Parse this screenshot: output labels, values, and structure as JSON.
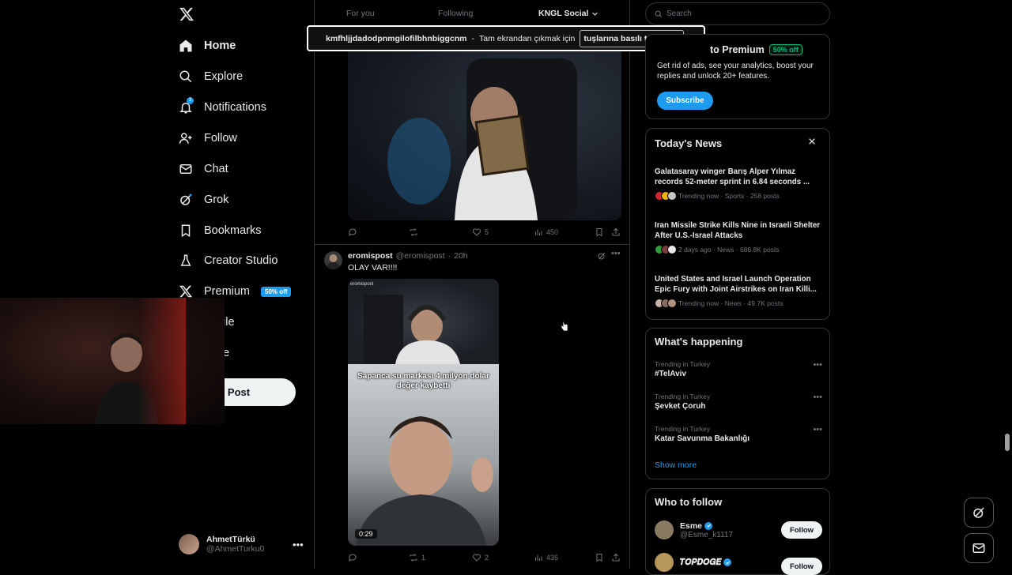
{
  "nav": {
    "items": [
      {
        "label": "Home",
        "icon": "home-icon"
      },
      {
        "label": "Explore",
        "icon": "search-icon"
      },
      {
        "label": "Notifications",
        "icon": "bell-icon",
        "badge": "3"
      },
      {
        "label": "Follow",
        "icon": "follow-icon"
      },
      {
        "label": "Chat",
        "icon": "mail-icon"
      },
      {
        "label": "Grok",
        "icon": "grok-icon"
      },
      {
        "label": "Bookmarks",
        "icon": "bookmark-icon"
      },
      {
        "label": "Creator Studio",
        "icon": "flask-icon"
      },
      {
        "label": "Premium",
        "icon": "x-icon",
        "pill": "50% off"
      },
      {
        "label": "ile"
      },
      {
        "label": "e"
      }
    ],
    "post_label": "Post",
    "me": {
      "name": "AhmetTürkü",
      "handle": "@AhmetTurku0"
    }
  },
  "feed": {
    "tabs": [
      "For you",
      "Following",
      "KNGL Social"
    ],
    "post1_actions": {
      "replies": "",
      "reposts": "",
      "likes": "5",
      "views": "450"
    },
    "post2": {
      "name": "eromispost",
      "handle": "@eromispost",
      "time": "20h",
      "text": "OLAY VAR!!!!",
      "media_brand": "eromispost",
      "media_caption": "Sapanca su markası 4 milyon dolar değer kaybetti",
      "duration": "0:29",
      "actions": {
        "replies": "",
        "reposts": "1",
        "likes": "2",
        "views": "435"
      }
    }
  },
  "toast": {
    "site": "kmfhljjdadodpnmgilofilbhnbiggcnm",
    "dash": "-",
    "text": "Tam ekrandan çıkmak için",
    "key_text": "tuşlarına basılı tutunEsc"
  },
  "right": {
    "search_placeholder": "Search",
    "premium": {
      "title": "to Premium",
      "pill": "50% off",
      "desc": "Get rid of ads, see your analytics, boost your replies and unlock 20+ features.",
      "button": "Subscribe"
    },
    "news": {
      "title": "Today's News",
      "items": [
        {
          "title": "Galatasaray winger Barış Alper Yılmaz records 52-meter sprint in 6.84 seconds ...",
          "meta": "Trending now · Sports · 258 posts"
        },
        {
          "title": "Iran Missile Strike Kills Nine in Israeli Shelter After U.S.-Israel Attacks",
          "meta": "2 days ago · News · 686.8K posts"
        },
        {
          "title": "United States and Israel Launch Operation Epic Fury with Joint Airstrikes on Iran Killi...",
          "meta": "Trending now · News · 49.7K posts"
        }
      ]
    },
    "happening": {
      "title": "What's happening",
      "items": [
        {
          "category": "Trending in Turkey",
          "name": "#TelAviv"
        },
        {
          "category": "Trending in Turkey",
          "name": "Şevket Çoruh"
        },
        {
          "category": "Trending in Turkey",
          "name": "Katar Savunma Bakanlığı"
        }
      ],
      "show_more": "Show more"
    },
    "who_to_follow": {
      "title": "Who to follow",
      "items": [
        {
          "name": "Esme",
          "handle": "@Esme_k1117",
          "button": "Follow"
        },
        {
          "name": "𝑻𝑶𝑷𝑫𝑶𝑮𝑬",
          "handle": "",
          "button": "Follow"
        }
      ]
    }
  },
  "colors": {
    "accent": "#1d9bf0",
    "bg": "#000000",
    "border": "#2f3336",
    "muted": "#71767b"
  }
}
